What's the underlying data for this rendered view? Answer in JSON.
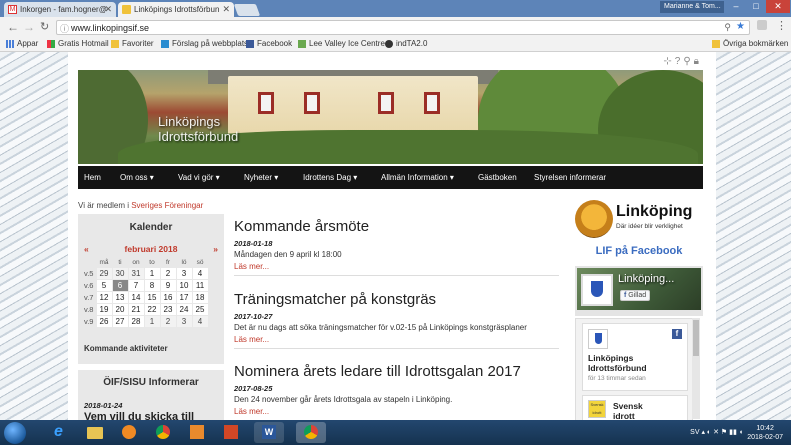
{
  "browser": {
    "tabs": [
      {
        "label": "Inkorgen - fam.hogner@",
        "active": false,
        "icon": "gmail-icon"
      },
      {
        "label": "Linköpings Idrottsförbun",
        "active": true,
        "icon": "site-icon"
      }
    ],
    "user": "Marianne & Tom...",
    "url": "www.linkopingsif.se",
    "bookmarks": [
      "Appar",
      "Gratis Hotmail",
      "Favoriter",
      "Förslag på webbplats",
      "Facebook",
      "Lee Valley Ice Centre",
      "indTA2.0"
    ],
    "other_bookmarks": "Övriga bokmärken"
  },
  "site": {
    "banner_title_line1": "Linköpings",
    "banner_title_line2": "Idrottsförbund",
    "nav": [
      "Hem",
      "Om oss ▾",
      "Vad vi gör ▾",
      "Nyheter ▾",
      "Idrottens Dag ▾",
      "Allmän Information ▾",
      "Gästboken",
      "Styrelsen informerar"
    ],
    "member_prefix": "Vi är medlem i",
    "member_link": "Sveriges Föreningar",
    "calendar": {
      "title": "Kalender",
      "prev": "«",
      "next": "»",
      "month": "februari 2018",
      "weekdays": [
        "må",
        "ti",
        "on",
        "to",
        "fr",
        "lö",
        "sö"
      ],
      "weeks": [
        {
          "wk": "v.5",
          "days": [
            "29",
            "30",
            "31",
            "1",
            "2",
            "3",
            "4"
          ]
        },
        {
          "wk": "v.6",
          "days": [
            "5",
            "6",
            "7",
            "8",
            "9",
            "10",
            "11"
          ]
        },
        {
          "wk": "v.7",
          "days": [
            "12",
            "13",
            "14",
            "15",
            "16",
            "17",
            "18"
          ]
        },
        {
          "wk": "v.8",
          "days": [
            "19",
            "20",
            "21",
            "22",
            "23",
            "24",
            "25"
          ]
        },
        {
          "wk": "v.9",
          "days": [
            "26",
            "27",
            "28",
            "1",
            "2",
            "3",
            "4"
          ]
        }
      ],
      "today": "6",
      "upcoming_label": "Kommande aktiviteter"
    },
    "informerar": {
      "title": "ÖIF/SISU Informerar",
      "date": "2018-01-24",
      "headline": "Vem vill du skicka till"
    },
    "articles": [
      {
        "title": "Kommande årsmöte",
        "date": "2018-01-18",
        "text": "Måndagen den 9 april kl 18:00",
        "more": "Läs mer..."
      },
      {
        "title": "Träningsmatcher på konstgräs",
        "date": "2017-10-27",
        "text": "Det är nu dags att söka träningsmatcher för v.02-15 på Linköpings konstgräsplaner",
        "more": "Läs mer..."
      },
      {
        "title": "Nominera årets ledare till Idrottsgalan 2017",
        "date": "2017-08-25",
        "text": "Den 24 november går årets Idrottsgala av stapeln i Linköping.",
        "more": "Läs mer..."
      }
    ],
    "sidebar": {
      "logo_name": "Linköping",
      "logo_tagline": "Där idéer blir verklighet",
      "fb_heading": "LIF på Facebook",
      "fb_page_name": "Linköping...",
      "fb_like": "Gillad",
      "post_name": "Linköpings Idrottsförbund",
      "post_time": "för 13 timmar sedan",
      "post2_name_line1": "Svensk",
      "post2_name_line2": "idrott",
      "post2_avatar_text": "Svensk idrott"
    }
  },
  "taskbar": {
    "lang": "SV",
    "time": "10:42",
    "date": "2018-02-07"
  },
  "colors": {
    "accent_red": "#c0392b",
    "nav_bg": "#141414",
    "fb_blue": "#3b6cc0"
  }
}
